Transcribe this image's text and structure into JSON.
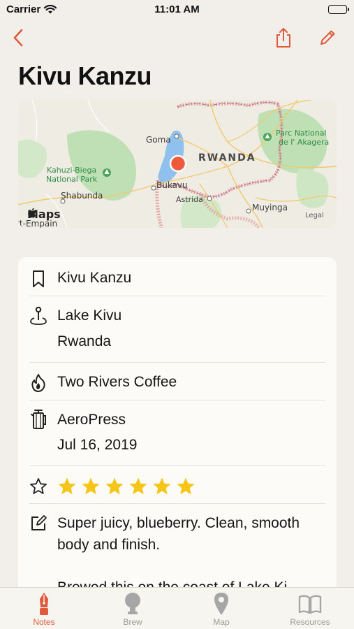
{
  "status_bar": {
    "carrier": "Carrier",
    "time": "11:01 AM"
  },
  "title": "Kivu Kanzu",
  "map": {
    "labels": {
      "goma": "Goma",
      "rwanda": "RWANDA",
      "parc": "Parc National",
      "parc2": "de l' Akagera",
      "kahuzi": "Kahuzi-Biega",
      "kahuzi2": "National Park",
      "shabunda": "Shabunda",
      "bukavu": "Bukavu",
      "astrida": "Astrida",
      "muyinga": "Muyinga",
      "brand": "Maps",
      "legal": "Legal",
      "cut": "rt-Empain"
    }
  },
  "details": {
    "name": "Kivu Kanzu",
    "region": "Lake Kivu",
    "country": "Rwanda",
    "roaster": "Two Rivers Coffee",
    "brew_method": "AeroPress",
    "date": "Jul 16, 2019",
    "rating": 6,
    "note_line1": "Super juicy, blueberry. Clean, smooth",
    "note_line2": "body and finish.",
    "note_line3": "Brewed this on the coast of Lake Ki..."
  },
  "tabs": [
    {
      "label": "Notes",
      "active": true
    },
    {
      "label": "Brew",
      "active": false
    },
    {
      "label": "Map",
      "active": false
    },
    {
      "label": "Resources",
      "active": false
    }
  ],
  "colors": {
    "accent": "#e05a3c",
    "star": "#f5c518",
    "park": "#bfe0b4",
    "lake": "#8fc0ee",
    "border": "#e08a8a"
  }
}
